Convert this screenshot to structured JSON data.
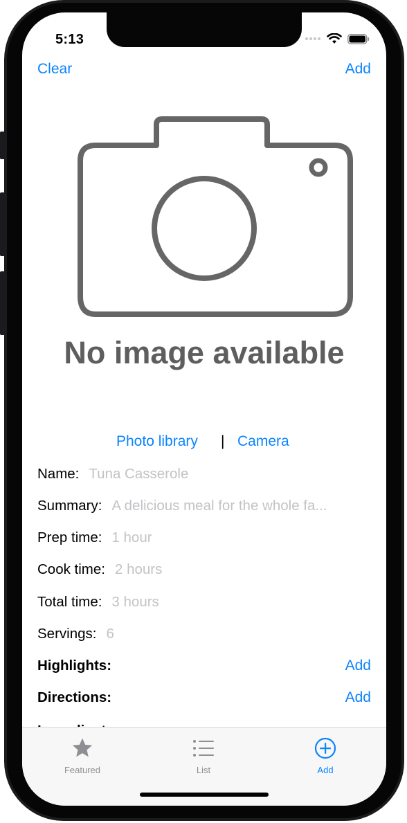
{
  "status_bar": {
    "time": "5:13",
    "icons": [
      "cellular-dots-icon",
      "wifi-icon",
      "battery-icon"
    ]
  },
  "nav": {
    "left_label": "Clear",
    "right_label": "Add"
  },
  "image_placeholder": {
    "icon": "camera-icon",
    "text": "No image available"
  },
  "photo_source": {
    "library_label": "Photo library",
    "separator": "|",
    "camera_label": "Camera"
  },
  "form": {
    "name": {
      "label": "Name:",
      "placeholder": "Tuna Casserole"
    },
    "summary": {
      "label": "Summary:",
      "placeholder": "A delicious meal for the whole fa..."
    },
    "prep_time": {
      "label": "Prep time:",
      "placeholder": "1 hour"
    },
    "cook_time": {
      "label": "Cook time:",
      "placeholder": "2 hours"
    },
    "total_time": {
      "label": "Total time:",
      "placeholder": "3 hours"
    },
    "servings": {
      "label": "Servings:",
      "placeholder": "6"
    }
  },
  "sections": {
    "highlights": {
      "label": "Highlights:",
      "add_label": "Add"
    },
    "directions": {
      "label": "Directions:",
      "add_label": "Add"
    },
    "ingredients": {
      "label": "Ingredients:"
    }
  },
  "tab_bar": {
    "tabs": [
      {
        "label": "Featured",
        "icon": "star-icon",
        "active": false
      },
      {
        "label": "List",
        "icon": "list-icon",
        "active": false
      },
      {
        "label": "Add",
        "icon": "plus-circle-icon",
        "active": true
      }
    ]
  },
  "colors": {
    "accent": "#0a84ff",
    "placeholder_text": "#c3c3c7",
    "tab_inactive": "#8e8e93",
    "camera_gray": "#666666"
  }
}
